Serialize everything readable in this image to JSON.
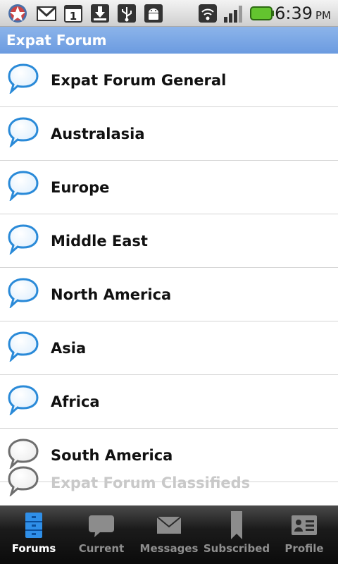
{
  "status_bar": {
    "icons": [
      "app-badge-icon",
      "gmail-icon",
      "calendar-icon",
      "download-icon",
      "usb-icon",
      "android-debug-icon",
      "wifi-icon",
      "signal-icon",
      "battery-icon"
    ],
    "calendar_day": "1",
    "time": "6:39",
    "ampm": "PM"
  },
  "header": {
    "title": "Expat Forum",
    "color": "#7aa7e6"
  },
  "forums": [
    {
      "label": "Expat Forum General",
      "unread": true
    },
    {
      "label": "Australasia",
      "unread": true
    },
    {
      "label": "Europe",
      "unread": true
    },
    {
      "label": "Middle East",
      "unread": true
    },
    {
      "label": "North America",
      "unread": true
    },
    {
      "label": "Asia",
      "unread": true
    },
    {
      "label": "Africa",
      "unread": true
    },
    {
      "label": "South America",
      "unread": false
    },
    {
      "label": "Expat Forum Classifieds",
      "unread": false
    }
  ],
  "tabs": [
    {
      "label": "Forums",
      "icon": "forums-icon",
      "active": true
    },
    {
      "label": "Current",
      "icon": "current-icon",
      "active": false
    },
    {
      "label": "Messages",
      "icon": "messages-icon",
      "active": false
    },
    {
      "label": "Subscribed",
      "icon": "subscribed-icon",
      "active": false
    },
    {
      "label": "Profile",
      "icon": "profile-icon",
      "active": false
    }
  ],
  "colors": {
    "bubble_blue": "#2a8ad8",
    "bubble_grey": "#6e6e6e",
    "active_tab": "#2f8fe8"
  }
}
